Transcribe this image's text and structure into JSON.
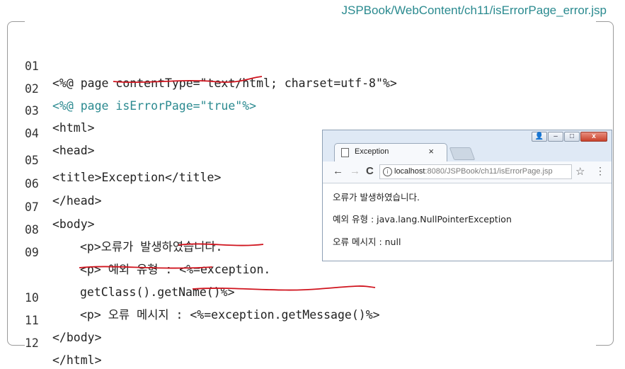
{
  "file_path": "JSPBook/WebContent/ch11/isErrorPage_error.jsp",
  "code_lines": [
    {
      "num": "01",
      "text": "<%@ page contentType=\"text/html; charset=utf-8\"%>"
    },
    {
      "num": "02",
      "text": "<%@ page isErrorPage=\"true\"%>"
    },
    {
      "num": "03",
      "text": "<html>"
    },
    {
      "num": "04",
      "text": "<head>"
    },
    {
      "num": "05",
      "text": "<title>Exception</title>"
    },
    {
      "num": "06",
      "text": "</head>"
    },
    {
      "num": "07",
      "text": "<body>"
    },
    {
      "num": "08",
      "text": "<p>오류가 발생하였습니다."
    },
    {
      "num": "09",
      "text": "<p> 예외 유형 : <%=exception."
    },
    {
      "num": "",
      "text": "getClass().getName()%>"
    },
    {
      "num": "10",
      "text": "<p> 오류 메시지 : <%=exception.getMessage()%>"
    },
    {
      "num": "11",
      "text": "</body>"
    },
    {
      "num": "12",
      "text": "</html>"
    }
  ],
  "browser": {
    "tab_title": "Exception",
    "tab_close": "×",
    "window_buttons": {
      "user": "👤",
      "minimize": "–",
      "maximize": "□",
      "close": "x"
    },
    "nav": {
      "back": "←",
      "forward": "→",
      "reload": "C"
    },
    "address_host": "localhost",
    "address_rest": ":8080/JSPBook/ch11/isErrorPage.jsp",
    "info_icon": "i",
    "star": "☆",
    "menu": "⋮",
    "content": [
      "오류가 발생하였습니다.",
      "예외 유형 : java.lang.NullPointerException",
      "오류 메시지 : null"
    ]
  },
  "colors": {
    "path": "#2a8a8f",
    "teal_code": "#2b8a90",
    "red_underline": "#d0141e"
  },
  "icons": [
    "document-icon",
    "info-icon",
    "star-icon",
    "menu-icon",
    "back-icon",
    "forward-icon",
    "reload-icon",
    "close-icon"
  ]
}
